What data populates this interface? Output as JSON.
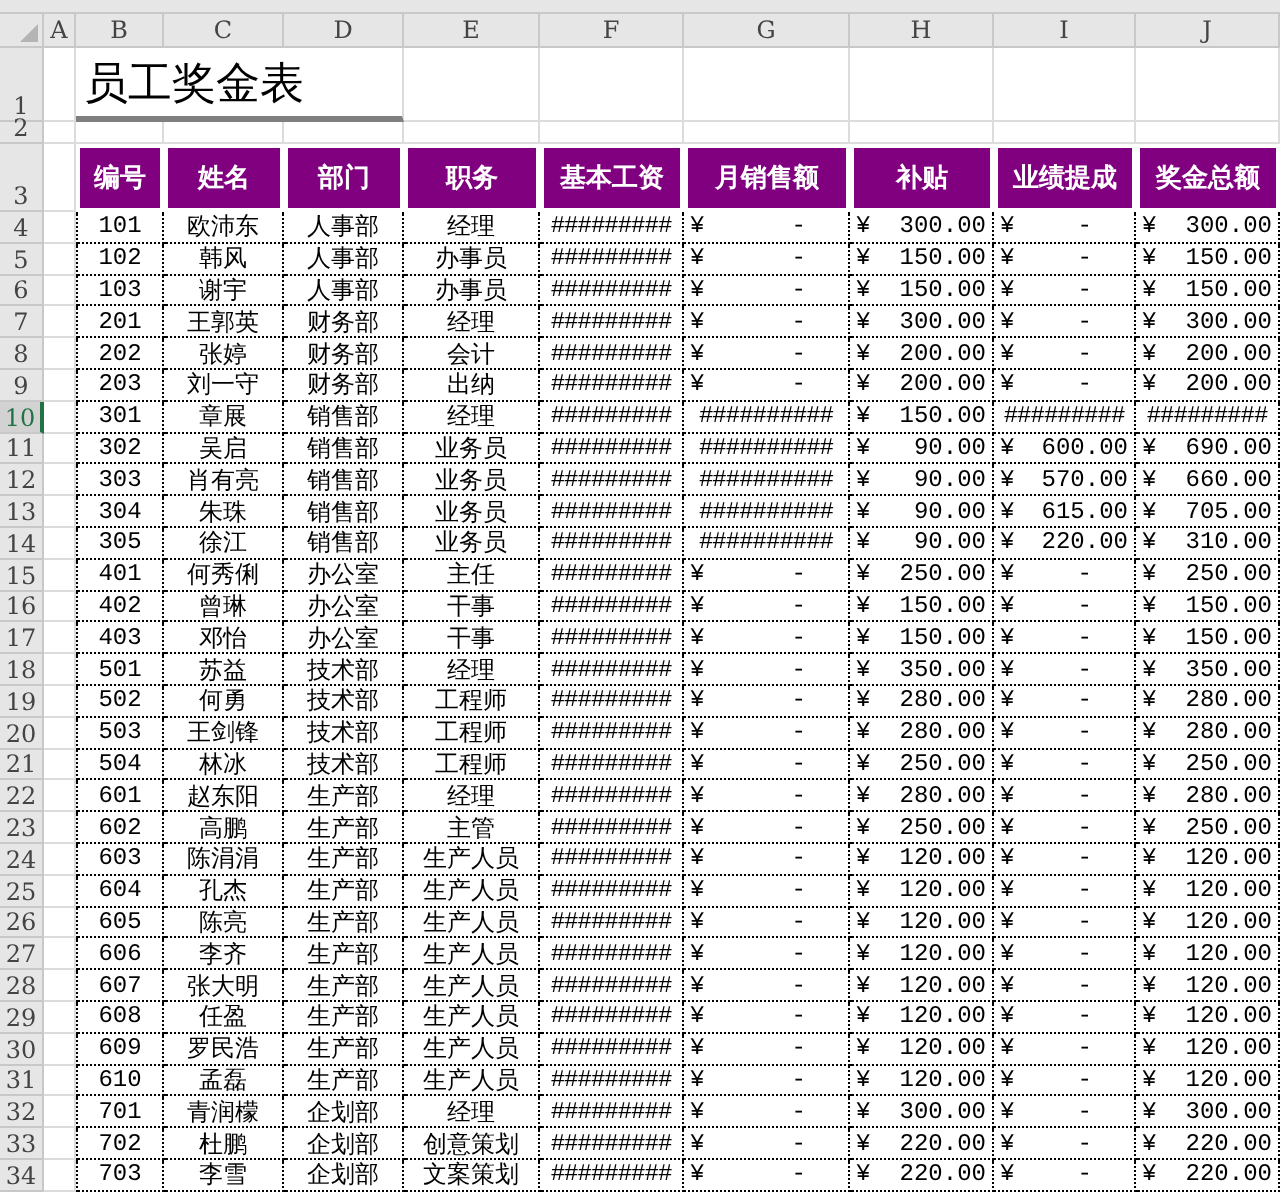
{
  "sheet": {
    "column_headers": [
      "A",
      "B",
      "C",
      "D",
      "E",
      "F",
      "G",
      "H",
      "I",
      "J"
    ],
    "title_rows": [
      {
        "number": "1",
        "selected": false
      },
      {
        "number": "2",
        "selected": false
      }
    ],
    "title": "员工奖金表",
    "header_row": {
      "number": "3",
      "selected": false,
      "cells": [
        "编号",
        "姓名",
        "部门",
        "职务",
        "基本工资",
        "月销售额",
        "补贴",
        "业绩提成",
        "奖金总额"
      ]
    },
    "rows": [
      {
        "number": "4",
        "selected": false,
        "id": "101",
        "name": "欧沛东",
        "department": "人事部",
        "position": "经理",
        "base_salary": "#########",
        "monthly_sales": {
          "symbol": "¥",
          "amount": "-"
        },
        "allowance": {
          "symbol": "¥",
          "amount": "300.00"
        },
        "commission": {
          "symbol": "¥",
          "amount": "-"
        },
        "total": {
          "symbol": "¥",
          "amount": "300.00"
        }
      },
      {
        "number": "5",
        "selected": false,
        "id": "102",
        "name": "韩风",
        "department": "人事部",
        "position": "办事员",
        "base_salary": "#########",
        "monthly_sales": {
          "symbol": "¥",
          "amount": "-"
        },
        "allowance": {
          "symbol": "¥",
          "amount": "150.00"
        },
        "commission": {
          "symbol": "¥",
          "amount": "-"
        },
        "total": {
          "symbol": "¥",
          "amount": "150.00"
        }
      },
      {
        "number": "6",
        "selected": false,
        "id": "103",
        "name": "谢宇",
        "department": "人事部",
        "position": "办事员",
        "base_salary": "#########",
        "monthly_sales": {
          "symbol": "¥",
          "amount": "-"
        },
        "allowance": {
          "symbol": "¥",
          "amount": "150.00"
        },
        "commission": {
          "symbol": "¥",
          "amount": "-"
        },
        "total": {
          "symbol": "¥",
          "amount": "150.00"
        }
      },
      {
        "number": "7",
        "selected": false,
        "id": "201",
        "name": "王郭英",
        "department": "财务部",
        "position": "经理",
        "base_salary": "#########",
        "monthly_sales": {
          "symbol": "¥",
          "amount": "-"
        },
        "allowance": {
          "symbol": "¥",
          "amount": "300.00"
        },
        "commission": {
          "symbol": "¥",
          "amount": "-"
        },
        "total": {
          "symbol": "¥",
          "amount": "300.00"
        }
      },
      {
        "number": "8",
        "selected": false,
        "id": "202",
        "name": "张婷",
        "department": "财务部",
        "position": "会计",
        "base_salary": "#########",
        "monthly_sales": {
          "symbol": "¥",
          "amount": "-"
        },
        "allowance": {
          "symbol": "¥",
          "amount": "200.00"
        },
        "commission": {
          "symbol": "¥",
          "amount": "-"
        },
        "total": {
          "symbol": "¥",
          "amount": "200.00"
        }
      },
      {
        "number": "9",
        "selected": false,
        "id": "203",
        "name": "刘一守",
        "department": "财务部",
        "position": "出纳",
        "base_salary": "#########",
        "monthly_sales": {
          "symbol": "¥",
          "amount": "-"
        },
        "allowance": {
          "symbol": "¥",
          "amount": "200.00"
        },
        "commission": {
          "symbol": "¥",
          "amount": "-"
        },
        "total": {
          "symbol": "¥",
          "amount": "200.00"
        }
      },
      {
        "number": "10",
        "selected": true,
        "id": "301",
        "name": "章展",
        "department": "销售部",
        "position": "经理",
        "base_salary": "#########",
        "monthly_sales": "##########",
        "allowance": {
          "symbol": "¥",
          "amount": "150.00"
        },
        "commission": "#########",
        "total": "#########"
      },
      {
        "number": "11",
        "selected": false,
        "id": "302",
        "name": "吴启",
        "department": "销售部",
        "position": "业务员",
        "base_salary": "#########",
        "monthly_sales": "##########",
        "allowance": {
          "symbol": "¥",
          "amount": "90.00"
        },
        "commission": {
          "symbol": "¥",
          "amount": "600.00"
        },
        "total": {
          "symbol": "¥",
          "amount": "690.00"
        }
      },
      {
        "number": "12",
        "selected": false,
        "id": "303",
        "name": "肖有亮",
        "department": "销售部",
        "position": "业务员",
        "base_salary": "#########",
        "monthly_sales": "##########",
        "allowance": {
          "symbol": "¥",
          "amount": "90.00"
        },
        "commission": {
          "symbol": "¥",
          "amount": "570.00"
        },
        "total": {
          "symbol": "¥",
          "amount": "660.00"
        }
      },
      {
        "number": "13",
        "selected": false,
        "id": "304",
        "name": "朱珠",
        "department": "销售部",
        "position": "业务员",
        "base_salary": "#########",
        "monthly_sales": "##########",
        "allowance": {
          "symbol": "¥",
          "amount": "90.00"
        },
        "commission": {
          "symbol": "¥",
          "amount": "615.00"
        },
        "total": {
          "symbol": "¥",
          "amount": "705.00"
        }
      },
      {
        "number": "14",
        "selected": false,
        "id": "305",
        "name": "徐江",
        "department": "销售部",
        "position": "业务员",
        "base_salary": "#########",
        "monthly_sales": "##########",
        "allowance": {
          "symbol": "¥",
          "amount": "90.00"
        },
        "commission": {
          "symbol": "¥",
          "amount": "220.00"
        },
        "total": {
          "symbol": "¥",
          "amount": "310.00"
        }
      },
      {
        "number": "15",
        "selected": false,
        "id": "401",
        "name": "何秀俐",
        "department": "办公室",
        "position": "主任",
        "base_salary": "#########",
        "monthly_sales": {
          "symbol": "¥",
          "amount": "-"
        },
        "allowance": {
          "symbol": "¥",
          "amount": "250.00"
        },
        "commission": {
          "symbol": "¥",
          "amount": "-"
        },
        "total": {
          "symbol": "¥",
          "amount": "250.00"
        }
      },
      {
        "number": "16",
        "selected": false,
        "id": "402",
        "name": "曾琳",
        "department": "办公室",
        "position": "干事",
        "base_salary": "#########",
        "monthly_sales": {
          "symbol": "¥",
          "amount": "-"
        },
        "allowance": {
          "symbol": "¥",
          "amount": "150.00"
        },
        "commission": {
          "symbol": "¥",
          "amount": "-"
        },
        "total": {
          "symbol": "¥",
          "amount": "150.00"
        }
      },
      {
        "number": "17",
        "selected": false,
        "id": "403",
        "name": "邓怡",
        "department": "办公室",
        "position": "干事",
        "base_salary": "#########",
        "monthly_sales": {
          "symbol": "¥",
          "amount": "-"
        },
        "allowance": {
          "symbol": "¥",
          "amount": "150.00"
        },
        "commission": {
          "symbol": "¥",
          "amount": "-"
        },
        "total": {
          "symbol": "¥",
          "amount": "150.00"
        }
      },
      {
        "number": "18",
        "selected": false,
        "id": "501",
        "name": "苏益",
        "department": "技术部",
        "position": "经理",
        "base_salary": "#########",
        "monthly_sales": {
          "symbol": "¥",
          "amount": "-"
        },
        "allowance": {
          "symbol": "¥",
          "amount": "350.00"
        },
        "commission": {
          "symbol": "¥",
          "amount": "-"
        },
        "total": {
          "symbol": "¥",
          "amount": "350.00"
        }
      },
      {
        "number": "19",
        "selected": false,
        "id": "502",
        "name": "何勇",
        "department": "技术部",
        "position": "工程师",
        "base_salary": "#########",
        "monthly_sales": {
          "symbol": "¥",
          "amount": "-"
        },
        "allowance": {
          "symbol": "¥",
          "amount": "280.00"
        },
        "commission": {
          "symbol": "¥",
          "amount": "-"
        },
        "total": {
          "symbol": "¥",
          "amount": "280.00"
        }
      },
      {
        "number": "20",
        "selected": false,
        "id": "503",
        "name": "王剑锋",
        "department": "技术部",
        "position": "工程师",
        "base_salary": "#########",
        "monthly_sales": {
          "symbol": "¥",
          "amount": "-"
        },
        "allowance": {
          "symbol": "¥",
          "amount": "280.00"
        },
        "commission": {
          "symbol": "¥",
          "amount": "-"
        },
        "total": {
          "symbol": "¥",
          "amount": "280.00"
        }
      },
      {
        "number": "21",
        "selected": false,
        "id": "504",
        "name": "林冰",
        "department": "技术部",
        "position": "工程师",
        "base_salary": "#########",
        "monthly_sales": {
          "symbol": "¥",
          "amount": "-"
        },
        "allowance": {
          "symbol": "¥",
          "amount": "250.00"
        },
        "commission": {
          "symbol": "¥",
          "amount": "-"
        },
        "total": {
          "symbol": "¥",
          "amount": "250.00"
        }
      },
      {
        "number": "22",
        "selected": false,
        "id": "601",
        "name": "赵东阳",
        "department": "生产部",
        "position": "经理",
        "base_salary": "#########",
        "monthly_sales": {
          "symbol": "¥",
          "amount": "-"
        },
        "allowance": {
          "symbol": "¥",
          "amount": "280.00"
        },
        "commission": {
          "symbol": "¥",
          "amount": "-"
        },
        "total": {
          "symbol": "¥",
          "amount": "280.00"
        }
      },
      {
        "number": "23",
        "selected": false,
        "id": "602",
        "name": "高鹏",
        "department": "生产部",
        "position": "主管",
        "base_salary": "#########",
        "monthly_sales": {
          "symbol": "¥",
          "amount": "-"
        },
        "allowance": {
          "symbol": "¥",
          "amount": "250.00"
        },
        "commission": {
          "symbol": "¥",
          "amount": "-"
        },
        "total": {
          "symbol": "¥",
          "amount": "250.00"
        }
      },
      {
        "number": "24",
        "selected": false,
        "id": "603",
        "name": "陈涓涓",
        "department": "生产部",
        "position": "生产人员",
        "base_salary": "#########",
        "monthly_sales": {
          "symbol": "¥",
          "amount": "-"
        },
        "allowance": {
          "symbol": "¥",
          "amount": "120.00"
        },
        "commission": {
          "symbol": "¥",
          "amount": "-"
        },
        "total": {
          "symbol": "¥",
          "amount": "120.00"
        }
      },
      {
        "number": "25",
        "selected": false,
        "id": "604",
        "name": "孔杰",
        "department": "生产部",
        "position": "生产人员",
        "base_salary": "#########",
        "monthly_sales": {
          "symbol": "¥",
          "amount": "-"
        },
        "allowance": {
          "symbol": "¥",
          "amount": "120.00"
        },
        "commission": {
          "symbol": "¥",
          "amount": "-"
        },
        "total": {
          "symbol": "¥",
          "amount": "120.00"
        }
      },
      {
        "number": "26",
        "selected": false,
        "id": "605",
        "name": "陈亮",
        "department": "生产部",
        "position": "生产人员",
        "base_salary": "#########",
        "monthly_sales": {
          "symbol": "¥",
          "amount": "-"
        },
        "allowance": {
          "symbol": "¥",
          "amount": "120.00"
        },
        "commission": {
          "symbol": "¥",
          "amount": "-"
        },
        "total": {
          "symbol": "¥",
          "amount": "120.00"
        }
      },
      {
        "number": "27",
        "selected": false,
        "id": "606",
        "name": "李齐",
        "department": "生产部",
        "position": "生产人员",
        "base_salary": "#########",
        "monthly_sales": {
          "symbol": "¥",
          "amount": "-"
        },
        "allowance": {
          "symbol": "¥",
          "amount": "120.00"
        },
        "commission": {
          "symbol": "¥",
          "amount": "-"
        },
        "total": {
          "symbol": "¥",
          "amount": "120.00"
        }
      },
      {
        "number": "28",
        "selected": false,
        "id": "607",
        "name": "张大明",
        "department": "生产部",
        "position": "生产人员",
        "base_salary": "#########",
        "monthly_sales": {
          "symbol": "¥",
          "amount": "-"
        },
        "allowance": {
          "symbol": "¥",
          "amount": "120.00"
        },
        "commission": {
          "symbol": "¥",
          "amount": "-"
        },
        "total": {
          "symbol": "¥",
          "amount": "120.00"
        }
      },
      {
        "number": "29",
        "selected": false,
        "id": "608",
        "name": "任盈",
        "department": "生产部",
        "position": "生产人员",
        "base_salary": "#########",
        "monthly_sales": {
          "symbol": "¥",
          "amount": "-"
        },
        "allowance": {
          "symbol": "¥",
          "amount": "120.00"
        },
        "commission": {
          "symbol": "¥",
          "amount": "-"
        },
        "total": {
          "symbol": "¥",
          "amount": "120.00"
        }
      },
      {
        "number": "30",
        "selected": false,
        "id": "609",
        "name": "罗民浩",
        "department": "生产部",
        "position": "生产人员",
        "base_salary": "#########",
        "monthly_sales": {
          "symbol": "¥",
          "amount": "-"
        },
        "allowance": {
          "symbol": "¥",
          "amount": "120.00"
        },
        "commission": {
          "symbol": "¥",
          "amount": "-"
        },
        "total": {
          "symbol": "¥",
          "amount": "120.00"
        }
      },
      {
        "number": "31",
        "selected": false,
        "id": "610",
        "name": "孟磊",
        "department": "生产部",
        "position": "生产人员",
        "base_salary": "#########",
        "monthly_sales": {
          "symbol": "¥",
          "amount": "-"
        },
        "allowance": {
          "symbol": "¥",
          "amount": "120.00"
        },
        "commission": {
          "symbol": "¥",
          "amount": "-"
        },
        "total": {
          "symbol": "¥",
          "amount": "120.00"
        }
      },
      {
        "number": "32",
        "selected": false,
        "id": "701",
        "name": "青润檬",
        "department": "企划部",
        "position": "经理",
        "base_salary": "#########",
        "monthly_sales": {
          "symbol": "¥",
          "amount": "-"
        },
        "allowance": {
          "symbol": "¥",
          "amount": "300.00"
        },
        "commission": {
          "symbol": "¥",
          "amount": "-"
        },
        "total": {
          "symbol": "¥",
          "amount": "300.00"
        }
      },
      {
        "number": "33",
        "selected": false,
        "id": "702",
        "name": "杜鹏",
        "department": "企划部",
        "position": "创意策划",
        "base_salary": "#########",
        "monthly_sales": {
          "symbol": "¥",
          "amount": "-"
        },
        "allowance": {
          "symbol": "¥",
          "amount": "220.00"
        },
        "commission": {
          "symbol": "¥",
          "amount": "-"
        },
        "total": {
          "symbol": "¥",
          "amount": "220.00"
        }
      },
      {
        "number": "34",
        "selected": false,
        "id": "703",
        "name": "李雪",
        "department": "企划部",
        "position": "文案策划",
        "base_salary": "#########",
        "monthly_sales": {
          "symbol": "¥",
          "amount": "-"
        },
        "allowance": {
          "symbol": "¥",
          "amount": "220.00"
        },
        "commission": {
          "symbol": "¥",
          "amount": "-"
        },
        "total": {
          "symbol": "¥",
          "amount": "220.00"
        }
      }
    ]
  }
}
